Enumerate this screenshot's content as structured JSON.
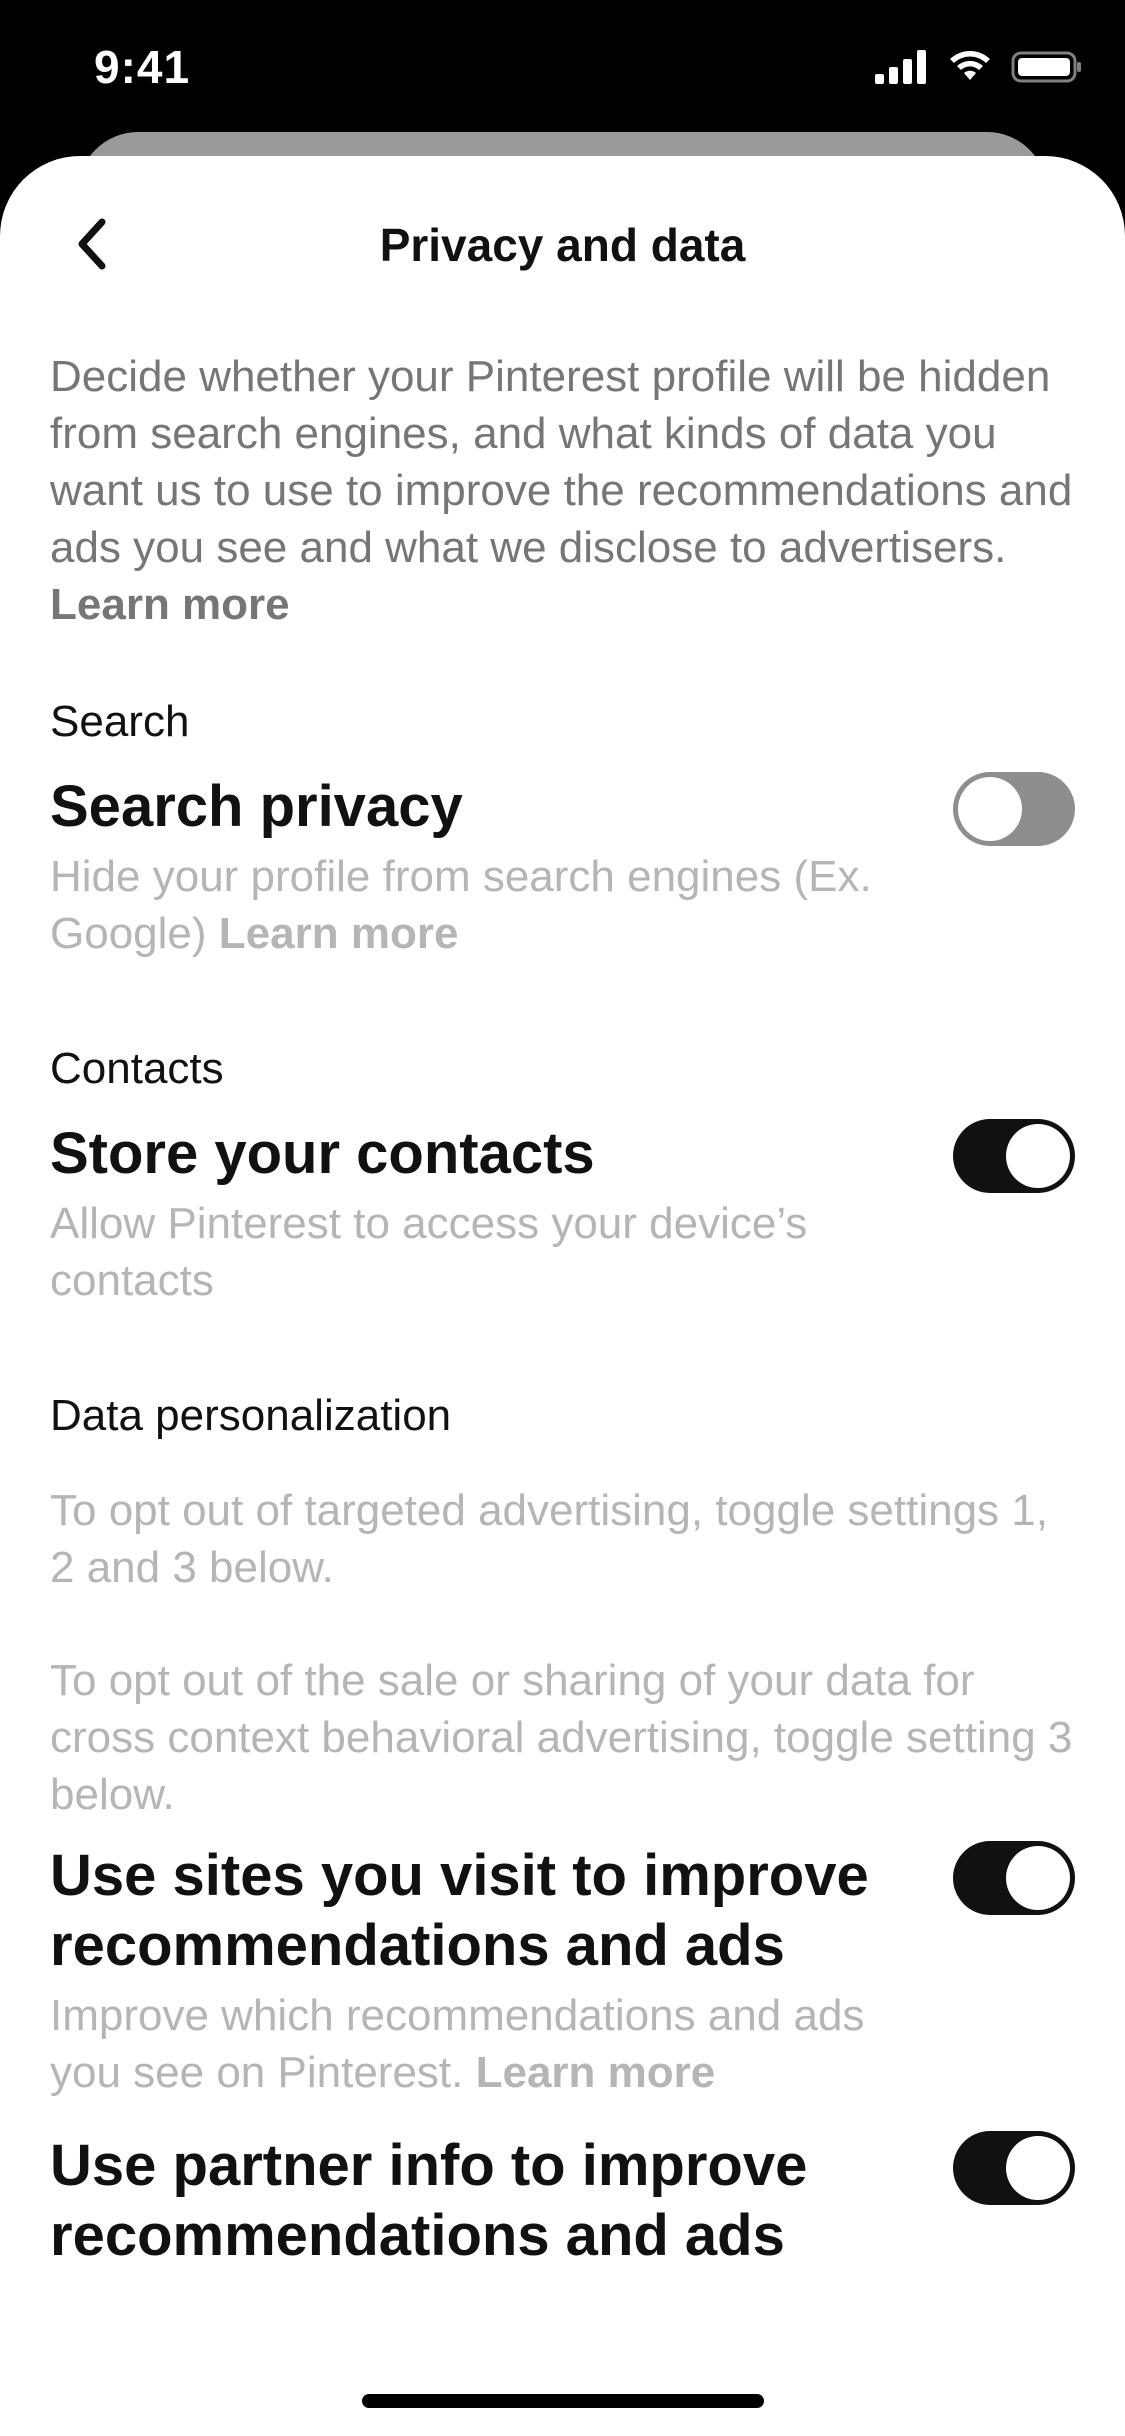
{
  "status_bar": {
    "time": "9:41",
    "icons": [
      "cellular-signal-icon",
      "wifi-icon",
      "battery-icon"
    ]
  },
  "header": {
    "title": "Privacy and data",
    "back_icon": "chevron-left-icon"
  },
  "intro": {
    "text": "Decide whether your Pinterest profile will be hidden from search engines, and what kinds of data you want us to use to improve the recommendations and ads you see and what we disclose to advertisers.",
    "learn_more": "Learn more"
  },
  "sections": {
    "search": {
      "label": "Search",
      "setting": {
        "title": "Search privacy",
        "description": "Hide your profile from search engines (Ex. Google)",
        "learn_more": "Learn more",
        "enabled": false
      }
    },
    "contacts": {
      "label": "Contacts",
      "setting": {
        "title": "Store your contacts",
        "description": "Allow Pinterest to access your device’s contacts",
        "enabled": true
      }
    },
    "data_personalization": {
      "label": "Data personalization",
      "info1": "To opt out of targeted advertising, toggle settings 1, 2 and 3 below.",
      "info2": "To opt out of the sale or sharing of your data for cross context behavioral advertising, toggle setting 3 below.",
      "settings": [
        {
          "title": "Use sites you visit to improve recommendations and ads",
          "description": "Improve which recommendations and ads you see on Pinterest.",
          "learn_more": "Learn more",
          "enabled": true
        },
        {
          "title": "Use partner info to improve recommendations and ads",
          "enabled": true
        }
      ]
    }
  },
  "colors": {
    "toggle_on": "#111111",
    "toggle_off": "#8e8e8e",
    "text_primary": "#111111",
    "text_secondary": "#767676",
    "text_muted": "#b5b5b5"
  }
}
